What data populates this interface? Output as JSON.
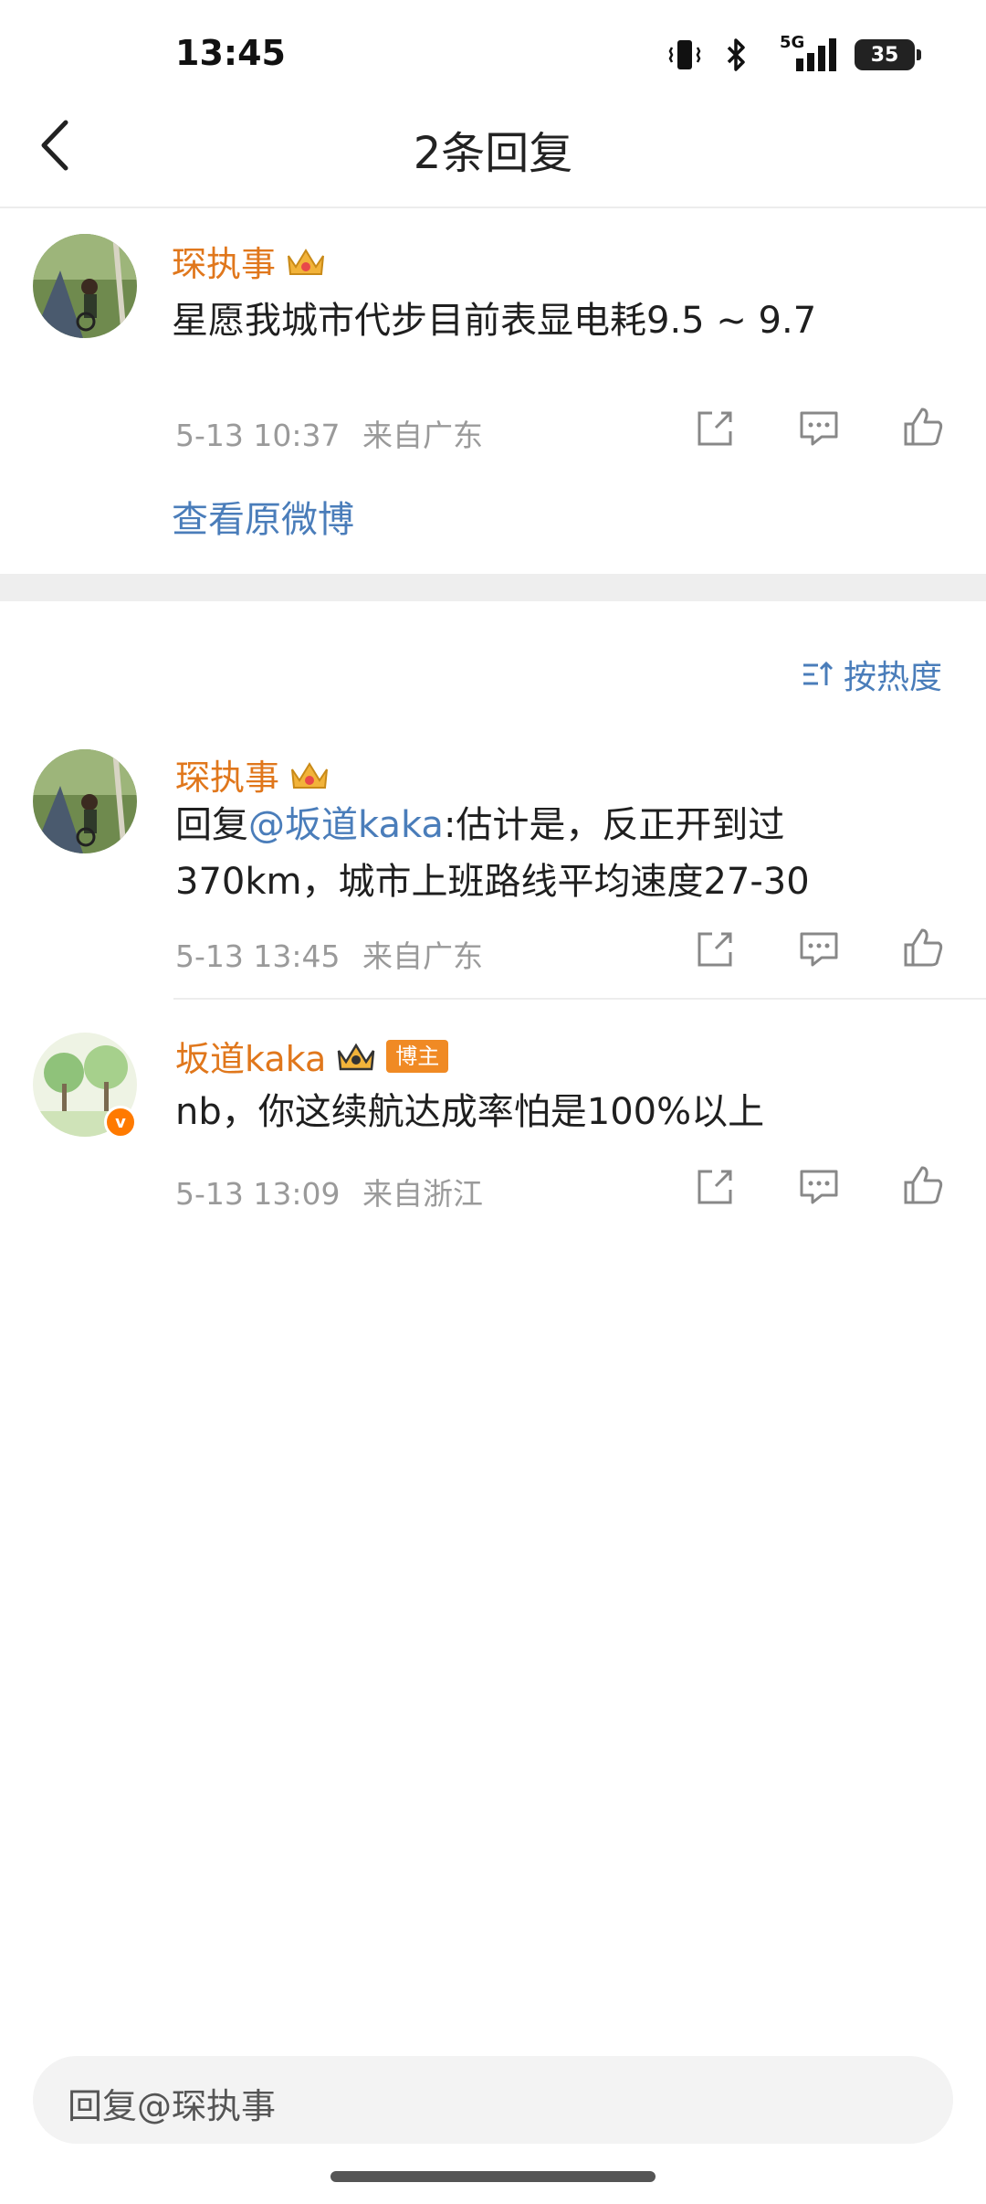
{
  "status_bar": {
    "time": "13:45",
    "network": "5G",
    "battery": "35"
  },
  "nav": {
    "title": "2条回复"
  },
  "original_comment": {
    "username": "琛执事",
    "text": "星愿我城市代步目前表显电耗9.5 ~ 9.7",
    "time": "5-13 10:37",
    "location": "来自广东",
    "view_original": "查看原微博"
  },
  "sort_label": "按热度",
  "replies": [
    {
      "username": "琛执事",
      "prefix": "回复",
      "mention": "@坂道kaka",
      "text_line1": ":估计是，反正开到过",
      "text_line2": "370km，城市上班路线平均速度27-30",
      "time": "5-13 13:45",
      "location": "来自广东"
    },
    {
      "username": "坂道kaka",
      "badge": "博主",
      "text": "nb，你这续航达成率怕是100%以上",
      "time": "5-13 13:09",
      "location": "来自浙江"
    }
  ],
  "reply_input": {
    "placeholder": "回复@琛执事"
  },
  "colors": {
    "username": "#e0771c",
    "link": "#4a7dba",
    "badge": "#f08a24"
  }
}
